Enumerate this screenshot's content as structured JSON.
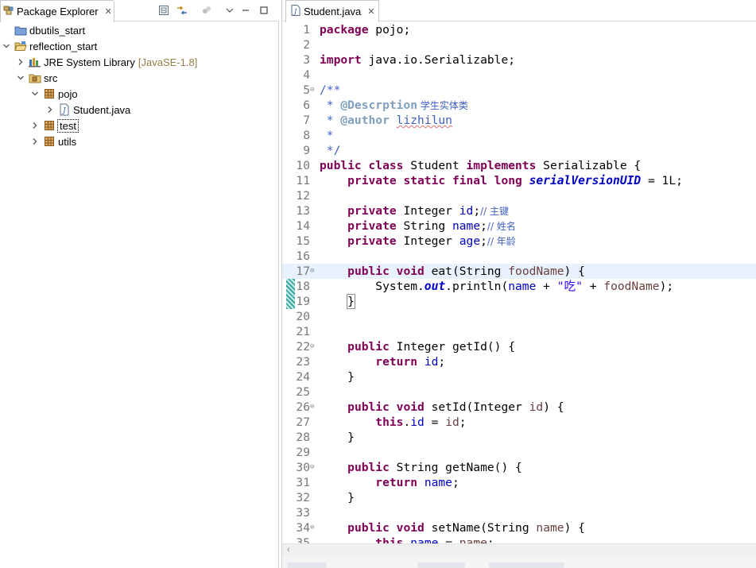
{
  "package_explorer": {
    "tab_title": "Package Explorer",
    "tree": [
      {
        "label": "dbutils_start",
        "decoration": ""
      },
      {
        "label": "reflection_start",
        "decoration": ""
      },
      {
        "label": "JRE System Library",
        "decoration": "[JavaSE-1.8]"
      },
      {
        "label": "src",
        "decoration": ""
      },
      {
        "label": "pojo",
        "decoration": ""
      },
      {
        "label": "Student.java",
        "decoration": ""
      },
      {
        "label": "test",
        "decoration": ""
      },
      {
        "label": "utils",
        "decoration": ""
      }
    ]
  },
  "editor": {
    "tab_title": "Student.java",
    "line_numbers": [
      "1",
      "2",
      "3",
      "4",
      "5",
      "6",
      "7",
      "8",
      "9",
      "10",
      "11",
      "12",
      "13",
      "14",
      "15",
      "16",
      "17",
      "18",
      "19",
      "20",
      "21",
      "22",
      "23",
      "24",
      "25",
      "26",
      "27",
      "28",
      "29",
      "30",
      "31",
      "32",
      "33",
      "34",
      "35"
    ],
    "tokens": {
      "l1_kw": "package",
      "l1_rest": " pojo;",
      "l3_kw": "import",
      "l3_rest": " java.io.Serializable;",
      "l5": "/**",
      "l6_star": " * ",
      "l6_tag": "@Descrption",
      "l6_text": " 学生实体类",
      "l7_star": " * ",
      "l7_tag": "@author",
      "l7_sp": " ",
      "l7_name": "lizhilun",
      "l8": " *",
      "l9": " */",
      "l10_kw1": "public class",
      "l10_mid": " Student ",
      "l10_kw2": "implements",
      "l10_rest": " Serializable {",
      "l11_ind": "    ",
      "l11_kw": "private static final long",
      "l11_sp": " ",
      "l11_field": "serialVersionUID",
      "l11_rest": " = 1L;",
      "l13_ind": "    ",
      "l13_kw": "private",
      "l13_type": " Integer ",
      "l13_field": "id",
      "l13_semi": ";",
      "l13_cm": "// 主键",
      "l14_ind": "    ",
      "l14_kw": "private",
      "l14_type": " String ",
      "l14_field": "name",
      "l14_semi": ";",
      "l14_cm": "// 姓名",
      "l15_ind": "    ",
      "l15_kw": "private",
      "l15_type": " Integer ",
      "l15_field": "age",
      "l15_semi": ";",
      "l15_cm": "// 年龄",
      "l17_ind": "    ",
      "l17_kw": "public void",
      "l17_mid": " eat(String ",
      "l17_param": "foodName",
      "l17_rest": ") {",
      "l18_ind": "        System.",
      "l18_out": "out",
      "l18_mid": ".println(",
      "l18_name": "name",
      "l18_plus": " + ",
      "l18_str": "\"吃\"",
      "l18_plus2": " + ",
      "l18_param": "foodName",
      "l18_end": ");",
      "l19_ind": "    ",
      "l19_brace": "}",
      "l22_ind": "    ",
      "l22_kw": "public",
      "l22_rest": " Integer getId() {",
      "l23_ind": "        ",
      "l23_kw": "return",
      "l23_sp": " ",
      "l23_field": "id",
      "l23_semi": ";",
      "l24": "    }",
      "l26_ind": "    ",
      "l26_kw": "public void",
      "l26_mid": " setId(Integer ",
      "l26_param": "id",
      "l26_rest": ") {",
      "l27_ind": "        ",
      "l27_kw": "this",
      "l27_dot": ".",
      "l27_field": "id",
      "l27_eq": " = ",
      "l27_param": "id",
      "l27_semi": ";",
      "l28": "    }",
      "l30_ind": "    ",
      "l30_kw": "public",
      "l30_rest": " String getName() {",
      "l31_ind": "        ",
      "l31_kw": "return",
      "l31_sp": " ",
      "l31_field": "name",
      "l31_semi": ";",
      "l32": "    }",
      "l34_ind": "    ",
      "l34_kw": "public void",
      "l34_mid": " setName(String ",
      "l34_param": "name",
      "l34_rest": ") {",
      "l35_ind": "        ",
      "l35_kw": "this",
      "l35_dot": ".",
      "l35_field": "name",
      "l35_eq": " = ",
      "l35_param": "name",
      "l35_semi": ";"
    }
  },
  "colors": {
    "keyword": "#7f0055",
    "comment": "#3f5fbf",
    "javadoc_tag": "#7f9fbf",
    "field": "#0000c0",
    "string": "#2a00ff",
    "current_line": "#e8f2fe"
  }
}
